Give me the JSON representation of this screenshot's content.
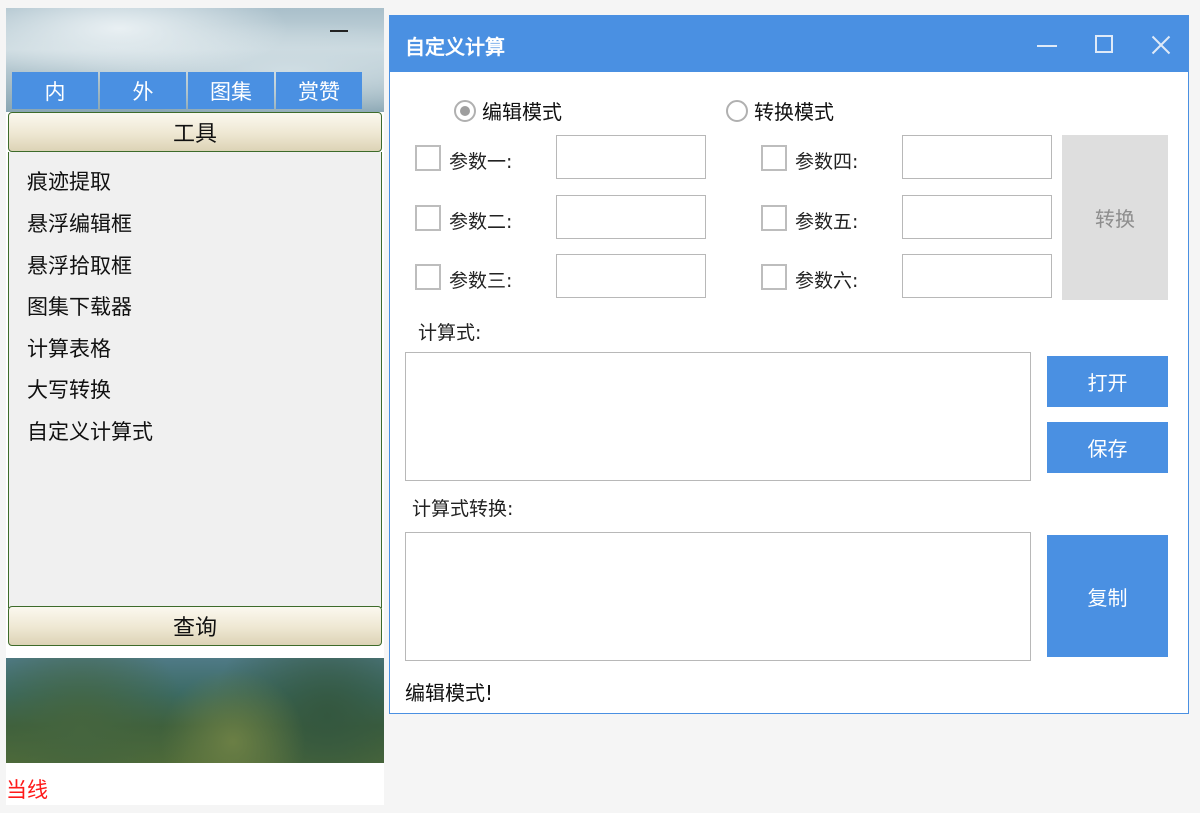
{
  "left_panel": {
    "tabs": [
      "内",
      "外",
      "图集",
      "赏赞"
    ],
    "tool_header": "工具",
    "tool_items": [
      "痕迹提取",
      "悬浮编辑框",
      "悬浮拾取框",
      "图集下载器",
      "计算表格",
      "大写转换",
      "自定义计算式"
    ],
    "query_header": "查询",
    "status": "当线"
  },
  "dialog": {
    "title": "自定义计算",
    "modes": {
      "edit": "编辑模式",
      "convert": "转换模式",
      "selected": "edit"
    },
    "params": [
      {
        "label": "参数一:",
        "value": "",
        "checked": false
      },
      {
        "label": "参数二:",
        "value": "",
        "checked": false
      },
      {
        "label": "参数三:",
        "value": "",
        "checked": false
      },
      {
        "label": "参数四:",
        "value": "",
        "checked": false
      },
      {
        "label": "参数五:",
        "value": "",
        "checked": false
      },
      {
        "label": "参数六:",
        "value": "",
        "checked": false
      }
    ],
    "convert_button": "转换",
    "formula_label": "计算式:",
    "formula_value": "",
    "open_button": "打开",
    "save_button": "保存",
    "converted_label": "计算式转换:",
    "converted_value": "",
    "copy_button": "复制",
    "status": "编辑模式!"
  },
  "colors": {
    "accent": "#4a90e2",
    "disabled_button": "#dedede",
    "status_red": "#ff1a1a"
  }
}
